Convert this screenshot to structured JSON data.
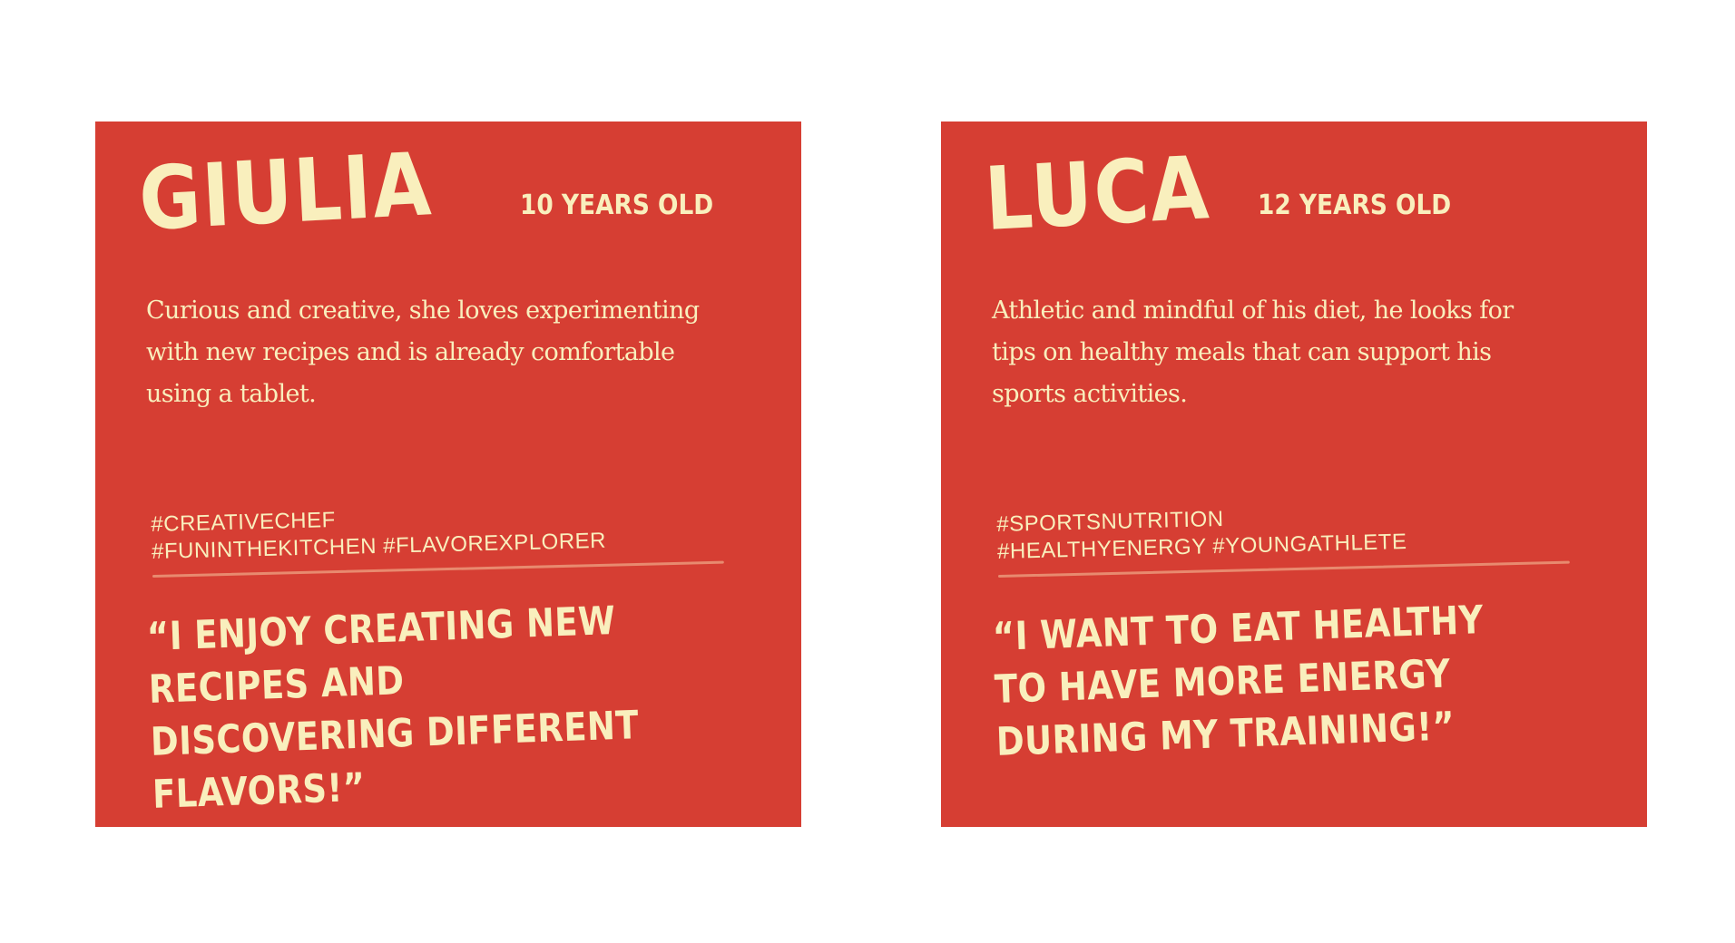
{
  "colors": {
    "background": "#ffffff",
    "card": "#d63e33",
    "text": "#f9efbd",
    "divider": "#e88a6f"
  },
  "personas": [
    {
      "name": "GIULIA",
      "age": "10 YEARS OLD",
      "description": "Curious and creative, she loves experimenting with new recipes and is already comfortable using a tablet.",
      "tags_line1": "#CREATIVECHEF",
      "tags_line2": "#FUNINTHEKITCHEN #FLAVOREXPLORER",
      "quote": "“I ENJOY CREATING NEW RECIPES AND DISCOVERING DIFFERENT FLAVORS!”"
    },
    {
      "name": "LUCA",
      "age": "12 YEARS OLD",
      "description": "Athletic and mindful of his diet, he looks for tips on healthy meals that can support his sports activities.",
      "tags_line1": "#SPORTSNUTRITION",
      "tags_line2": "#HEALTHYENERGY #YOUNGATHLETE",
      "quote": "“I WANT TO EAT HEALTHY TO HAVE MORE ENERGY DURING MY TRAINING!”"
    }
  ]
}
